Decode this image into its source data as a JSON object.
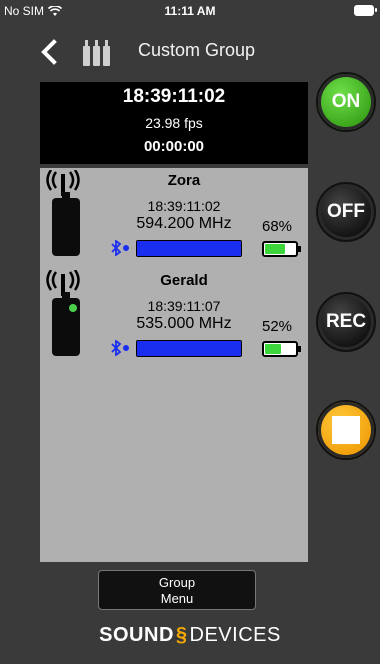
{
  "status_bar": {
    "carrier": "No SIM",
    "time": "11:11 AM"
  },
  "nav": {
    "title": "Custom Group",
    "back_icon": "chevron-left-icon",
    "group_icon": "transmitter-group-icon"
  },
  "timecode": {
    "main": "18:39:11:02",
    "fps": "23.98 fps",
    "offset": "00:00:00"
  },
  "devices": [
    {
      "name": "Zora",
      "timecode": "18:39:11:02",
      "frequency": "594.200 MHz",
      "battery_pct": "68%",
      "battery_level": 0.68,
      "audio_level": 1.0,
      "led": false
    },
    {
      "name": "Gerald",
      "timecode": "18:39:11:07",
      "frequency": "535.000 MHz",
      "battery_pct": "52%",
      "battery_level": 0.52,
      "audio_level": 1.0,
      "led": true
    }
  ],
  "buttons": {
    "on": "ON",
    "off": "OFF",
    "rec": "REC"
  },
  "menu": {
    "line1": "Group",
    "line2": "Menu"
  },
  "brand": {
    "part1": "SOUND",
    "part2": "DEVICES"
  },
  "colors": {
    "on": "#3aa31a",
    "stop": "#f0a00a",
    "level": "#1a2ef0",
    "battery": "#3cd63c"
  }
}
